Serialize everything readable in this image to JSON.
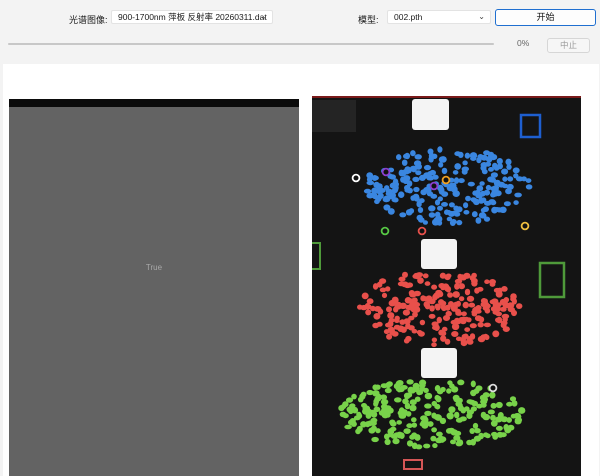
{
  "toolbar": {
    "image_label": "光谱图像:",
    "image_value": "900-1700nm 萍板 反射率 20260311.dat",
    "model_label": "模型:",
    "model_value": "002.pth",
    "start_label": "开始",
    "progress_percent": 0,
    "progress_text": "0%",
    "stop_label": "中止"
  },
  "left_view": {
    "placeholder_text": "True"
  },
  "icons": {
    "dropdown": "chevron-down-icon"
  },
  "colors": {
    "accent": "#1f6fd0",
    "class_blue": "#3a86e0",
    "class_red": "#e8504b",
    "class_green": "#78d24a"
  }
}
